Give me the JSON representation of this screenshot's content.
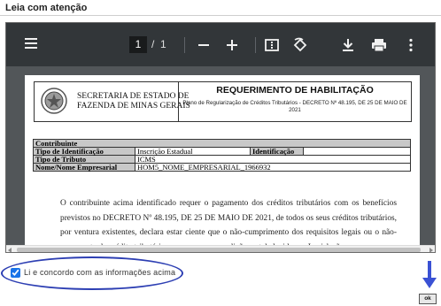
{
  "dialog": {
    "title": "Leia com atenção"
  },
  "viewer": {
    "current_page": "1",
    "page_separator": "/",
    "total_pages": "1"
  },
  "document": {
    "org_line1": "SECRETARIA DE ESTADO DE",
    "org_line2": "FAZENDA DE MINAS GERAIS",
    "title": "REQUERIMENTO DE HABILITAÇÃO",
    "subtitle": "Plano de Regularização de Créditos Tributários - DECRETO Nº 48.195, DE 25 DE MAIO DE 2021",
    "section_header": "Contribuinte",
    "rows": {
      "id_type_label": "Tipo de Identificação",
      "id_type_value": "Inscrição Estadual",
      "id_label": "Identificação",
      "id_value": "",
      "tax_type_label": "Tipo de Tributo",
      "tax_type_value": "ICMS",
      "business_name_label": "Nome/Nome Empresarial",
      "business_name_value": "HOM5_NOME_EMPRESARIAL_1966932"
    },
    "body_text": "O contribuinte acima identificado requer o pagamento dos créditos tributários com os benefícios previstos no DECRETO Nº 48.195, DE 25 DE MAIO DE 2021, de todos os seus créditos tributários, por ventura existentes, declara estar ciente que o não-cumprimento dos requisitos legais ou o não-pagamento do crédito tributário no prazo e nas condições estabelecidas na Legislação"
  },
  "agreement": {
    "label": "Li e concordo com as informações acima",
    "checked": true
  },
  "ok_button": {
    "label": "ok"
  },
  "colors": {
    "toolbar": "#323639",
    "viewer_bg": "#525659",
    "annotation": "#2d3fb3"
  }
}
